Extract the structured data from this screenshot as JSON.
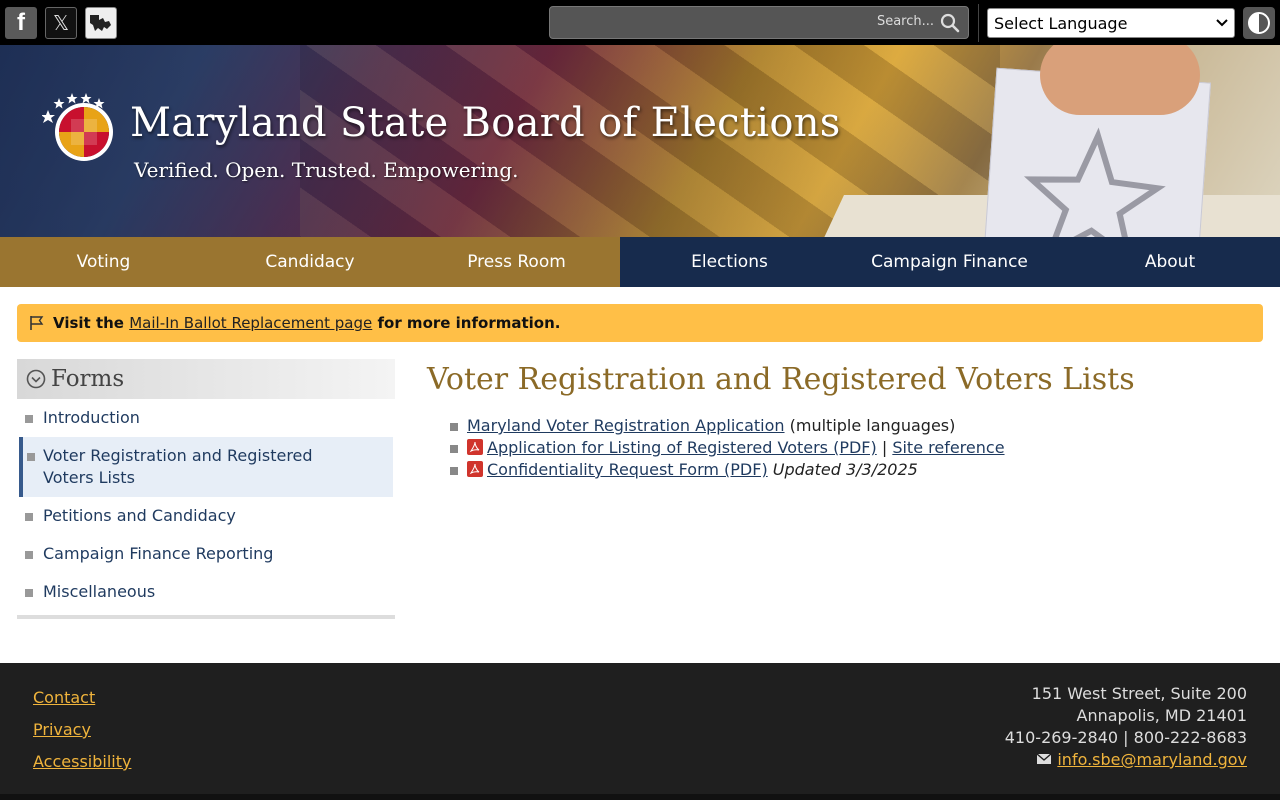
{
  "topbar": {
    "social": [
      {
        "name": "facebook-icon",
        "glyph": "f"
      },
      {
        "name": "x-twitter-icon",
        "glyph": "𝕏"
      },
      {
        "name": "maryland-icon",
        "glyph": ""
      }
    ],
    "search_placeholder": "Search...",
    "language_selected": "Select Language"
  },
  "banner": {
    "title": "Maryland State Board of Elections",
    "tagline": "Verified.  Open.  Trusted.  Empowering."
  },
  "nav": {
    "items": [
      {
        "label": "Voting",
        "theme": "gold"
      },
      {
        "label": "Candidacy",
        "theme": "gold"
      },
      {
        "label": "Press Room",
        "theme": "gold"
      },
      {
        "label": "Elections",
        "theme": "navy"
      },
      {
        "label": "Campaign Finance",
        "theme": "navy"
      },
      {
        "label": "About",
        "theme": "navy"
      }
    ]
  },
  "alert": {
    "prefix": "Visit the",
    "link": "Mail-In Ballot Replacement page",
    "suffix": "for more information."
  },
  "sidebar": {
    "heading": "Forms",
    "items": [
      {
        "label": "Introduction",
        "active": false
      },
      {
        "label": "Voter Registration and Registered Voters Lists",
        "active": true
      },
      {
        "label": "Petitions and Candidacy",
        "active": false
      },
      {
        "label": "Campaign Finance Reporting",
        "active": false
      },
      {
        "label": "Miscellaneous",
        "active": false
      }
    ]
  },
  "main": {
    "title": "Voter Registration and Registered Voters Lists",
    "docs": [
      {
        "link": "Maryland Voter Registration Application",
        "note": "(multiple languages)"
      },
      {
        "link": "Application for Listing of Registered Voters (PDF)",
        "separator": "|",
        "extra_link": "Site reference"
      },
      {
        "link": "Confidentiality Request Form (PDF)",
        "updated": "Updated 3/3/2025"
      }
    ]
  },
  "footer": {
    "links": [
      "Contact",
      "Privacy",
      "Accessibility"
    ],
    "address_line1": "151 West Street, Suite 200",
    "address_line2": "Annapolis, MD 21401",
    "phones": "410-269-2840 | 800-222-8683",
    "email": "info.sbe@maryland.gov"
  },
  "colors": {
    "nav_gold": "#9a7530",
    "nav_navy": "#172b4d",
    "alert_bg": "#ffbf47",
    "title_gold": "#8b6a27",
    "footer_bg": "#1f1f1f",
    "footer_link": "#f0b43c"
  }
}
